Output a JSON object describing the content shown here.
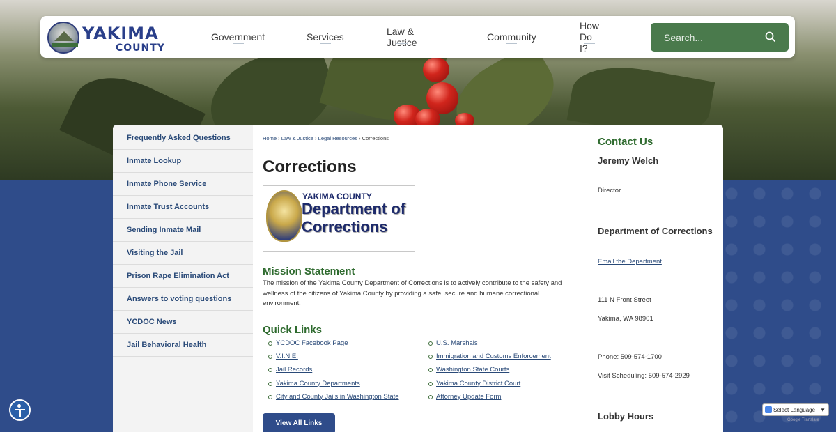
{
  "header": {
    "logo_line1": "YAKIMA",
    "logo_line2": "COUNTY",
    "nav": [
      "Government",
      "Services",
      "Law & Justice",
      "Community",
      "How Do I?"
    ],
    "search_placeholder": "Search..."
  },
  "sidebar": {
    "items": [
      "Frequently Asked Questions",
      "Inmate Lookup",
      "Inmate Phone Service",
      "Inmate Trust Accounts",
      "Sending Inmate Mail",
      "Visiting the Jail",
      "Prison Rape Elimination Act",
      "Answers to voting questions",
      "YCDOC News",
      "Jail Behavioral Health"
    ]
  },
  "breadcrumb": {
    "home": "Home",
    "law": "Law & Justice",
    "legal": "Legal Resources",
    "current": "Corrections",
    "sep": "›"
  },
  "page": {
    "title": "Corrections",
    "image_line1": "YAKIMA COUNTY",
    "image_line2": "Department of",
    "image_line3": "Corrections",
    "mission_heading": "Mission Statement",
    "mission_text": "The mission of the Yakima County Department of Corrections is to actively contribute to the safety and wellness of the citizens of Yakima County by providing a safe, secure and humane correctional environment.",
    "quick_links_heading": "Quick Links",
    "quick_links_col1": [
      "YCDOC Facebook Page",
      "V.I.N.E.",
      "Jail Records",
      "Yakima County Departments",
      "City and County Jails in Washington State"
    ],
    "quick_links_col2": [
      "U.S. Marshals",
      "Immigration and Customs Enforcement",
      "Washington State Courts",
      "Yakima County District Court",
      "Attorney Update Form"
    ],
    "view_all": "View All Links"
  },
  "contact": {
    "heading": "Contact Us",
    "name": "Jeremy Welch",
    "role": "Director",
    "dept": "Department of Corrections",
    "email": "Email the Department",
    "address1": "111 N Front Street",
    "address2": "Yakima, WA 98901",
    "phone": "Phone: 509-574-1700",
    "visit": "Visit Scheduling: 509-574-2929",
    "lobby": "Lobby Hours"
  },
  "translate": {
    "label": "Select Language",
    "powered": "Google Translate"
  },
  "colors": {
    "brand_blue": "#2f4c8a",
    "accent_green": "#4a7a4c",
    "heading_green": "#2f6b2f"
  }
}
